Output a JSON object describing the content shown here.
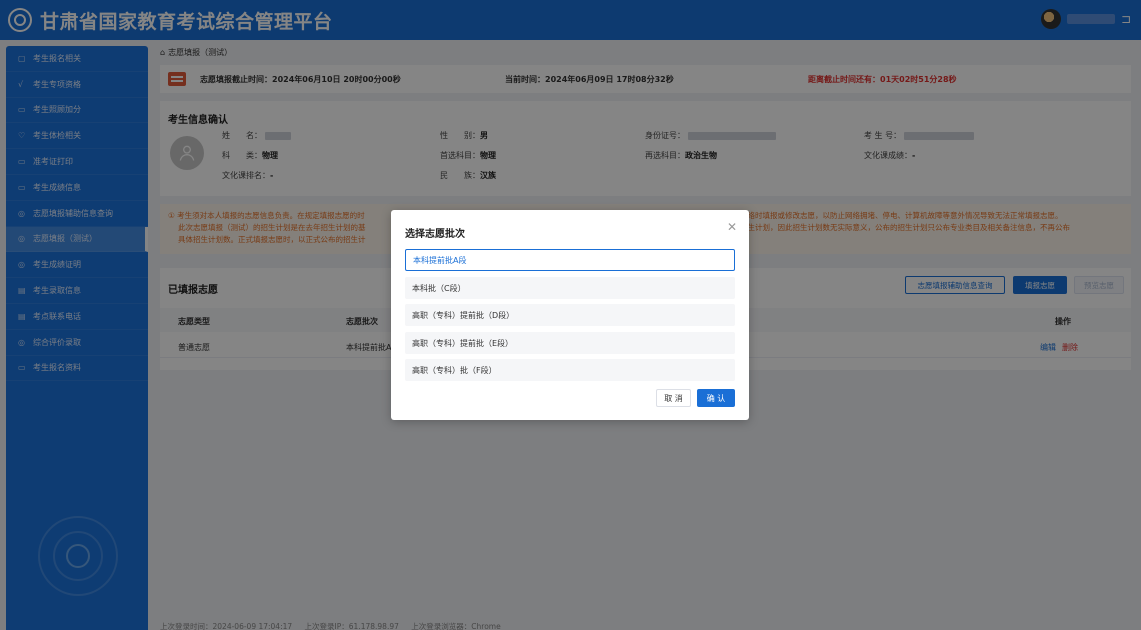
{
  "header": {
    "title": "甘肃省国家教育考试综合管理平台"
  },
  "sidebar": {
    "items": [
      {
        "label": "考生报名相关",
        "icon": "clipboard-icon",
        "glyph": "▢"
      },
      {
        "label": "考生专项资格",
        "icon": "check-icon",
        "glyph": "√"
      },
      {
        "label": "考生照顾加分",
        "icon": "card-icon",
        "glyph": "▭"
      },
      {
        "label": "考生体检相关",
        "icon": "heart-icon",
        "glyph": "♡"
      },
      {
        "label": "准考证打印",
        "icon": "id-card-icon",
        "glyph": "▭"
      },
      {
        "label": "考生成绩信息",
        "icon": "score-icon",
        "glyph": "▭"
      },
      {
        "label": "志愿填报辅助信息查询",
        "icon": "search-icon",
        "glyph": "◎"
      },
      {
        "label": "志愿填报（测试）",
        "icon": "edit-icon",
        "glyph": "◎"
      },
      {
        "label": "考生成绩证明",
        "icon": "certificate-icon",
        "glyph": "◎"
      },
      {
        "label": "考生录取信息",
        "icon": "document-icon",
        "glyph": "▤"
      },
      {
        "label": "考点联系电话",
        "icon": "phone-icon",
        "glyph": "▤"
      },
      {
        "label": "综合评价录取",
        "icon": "evaluate-icon",
        "glyph": "◎"
      },
      {
        "label": "考生报名资料",
        "icon": "folder-icon",
        "glyph": "▭"
      }
    ],
    "active_index": 7
  },
  "breadcrumb": {
    "label": "志愿填报（测试）"
  },
  "deadline": {
    "deadline_text": "志愿填报截止时间：2024年06月10日 20时00分00秒",
    "current_text": "当前时间：2024年06月09日 17时08分32秒",
    "remaining_text": "距离截止时间还有：01天02时51分28秒"
  },
  "candidate": {
    "title": "考生信息确认",
    "name_label": "姓　　名：",
    "subject_label": "科　　类：",
    "subject_value": "物理",
    "culture_name_label": "文化课排名：",
    "culture_name_value": "-",
    "gender_label": "性　　别：",
    "gender_value": "男",
    "first_subject_label": "首选科目：",
    "first_subject_value": "物理",
    "ethnicity_label": "民　　族：",
    "ethnicity_value": "汉族",
    "idcard_label": "身份证号：",
    "second_subject_label": "再选科目：",
    "second_subject_value": "政治生物",
    "exam_no_label": "考 生 号：",
    "culture_score_label": "文化课成绩：",
    "culture_score_value": "-"
  },
  "notice": {
    "line1_left": "① 考生须对本人填报的志愿信息负责。在规定填报志愿的时",
    "line1_right": "网络时填报或修改志愿，以防止网络拥堵、停电、计算机故障等意外情况导致无法正常填报志愿。",
    "line2_left": "此次志愿填报（测试）的招生计划是在去年招生计划的基",
    "line2_right": "招生计划，因此招生计划数无实际意义，公布的招生计划只公布专业类目及相关备注信息，不再公布",
    "line3_left": "具体招生计划数。正式填报志愿时，以正式公布的招生计"
  },
  "filled": {
    "title": "已填报志愿",
    "assist_button": "志愿填报辅助信息查询",
    "fill_button": "填报志愿",
    "preview_button": "预览志愿",
    "columns": {
      "type": "志愿类型",
      "batch": "志愿批次",
      "action": "操作"
    },
    "rows": [
      {
        "type": "普通志愿",
        "batch": "本科提前批A",
        "edit": "编辑",
        "delete": "删除"
      }
    ]
  },
  "footer": {
    "last_time": "上次登录时间：2024-06-09 17:04:17",
    "last_ip": "上次登录IP：61.178.98.97",
    "last_browser": "上次登录浏览器：Chrome"
  },
  "modal": {
    "title": "选择志愿批次",
    "options": [
      "本科提前批A段",
      "本科批（C段）",
      "高职（专科）提前批（D段）",
      "高职（专科）提前批（E段）",
      "高职（专科）批（F段）"
    ],
    "selected_index": 0,
    "cancel_label": "取 消",
    "ok_label": "确 认"
  },
  "colors": {
    "primary": "#1a6fd6",
    "danger": "#e0302f",
    "warning": "#e6722a"
  }
}
